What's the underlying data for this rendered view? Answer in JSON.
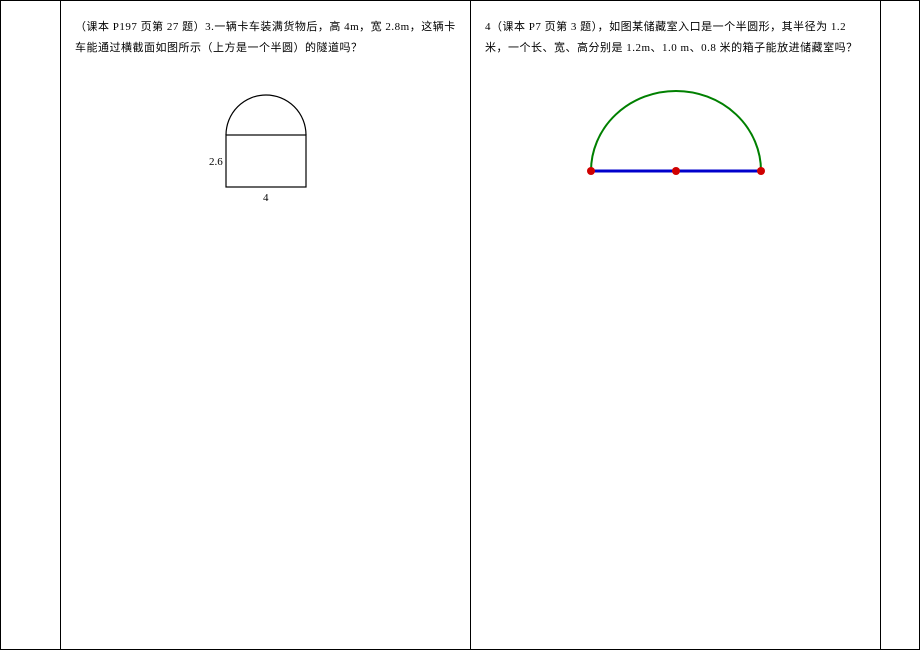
{
  "left": {
    "source_prefix": "（课本 P197 页第 27 题）3.",
    "body": "一辆卡车装满货物后，高 4m，宽 2.8m，这辆卡车能通过横截面如图所示（上方是一个半圆）的隧道吗？",
    "figure": {
      "height_label": "2.6",
      "width_label": "4"
    }
  },
  "right": {
    "source_prefix": "4（课本 P7 页第 3 题），",
    "body": "如图某储藏室入口是一个半圆形，其半径为 1.2 米，一个长、宽、高分别是 1.2m、1.0 m、0.8 米的箱子能放进储藏室吗？"
  },
  "chart_data": [
    {
      "type": "diagram",
      "description": "Tunnel cross-section: rectangle with a semicircle on top",
      "rect_width": 4,
      "rect_height": 2.6,
      "top_shape": "semicircle",
      "semicircle_diameter": 4
    },
    {
      "type": "diagram",
      "description": "Semicircular storeroom entrance with three marked points on diameter",
      "radius": 1.2,
      "points_on_diameter": 3
    }
  ]
}
